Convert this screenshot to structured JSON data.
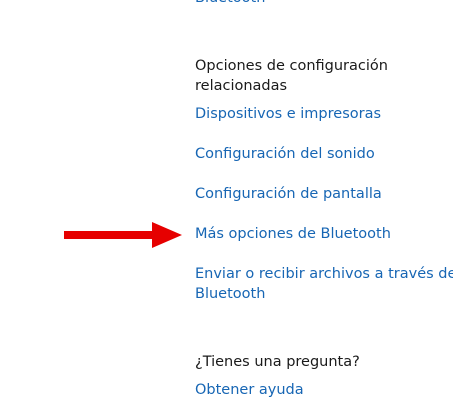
{
  "top_partial_link": "Bluetooth",
  "related_settings": {
    "heading_line1": "Opciones de configuración",
    "heading_line2": "relacionadas",
    "links": [
      {
        "label": "Dispositivos e impresoras"
      },
      {
        "label": "Configuración del sonido"
      },
      {
        "label": "Configuración de pantalla"
      },
      {
        "label": "Más opciones de Bluetooth"
      },
      {
        "label_line1": "Enviar o recibir archivos a través de",
        "label_line2": "Bluetooth"
      }
    ]
  },
  "question": {
    "heading": "¿Tienes una pregunta?",
    "help_link": "Obtener ayuda"
  },
  "colors": {
    "link": "#1766b4",
    "text": "#1a1a1a",
    "arrow": "#e60000",
    "background": "#ffffff"
  },
  "annotation": {
    "icon": "red-arrow-icon",
    "points_to": "Más opciones de Bluetooth"
  }
}
